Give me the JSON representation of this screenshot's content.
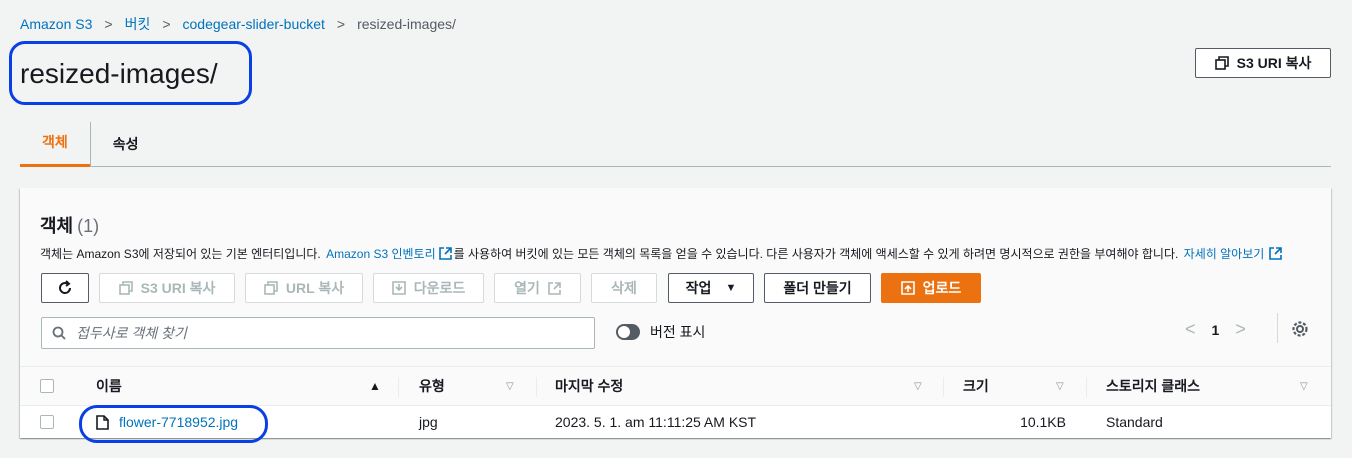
{
  "breadcrumb": [
    "Amazon S3",
    "버킷",
    "codegear-slider-bucket",
    "resized-images/"
  ],
  "title": "resized-images/",
  "s3_uri_copy_label": "S3 URI 복사",
  "tabs": [
    {
      "label": "객체",
      "active": true
    },
    {
      "label": "속성",
      "active": false
    }
  ],
  "panel": {
    "title": "객체",
    "count": "(1)",
    "desc_before": "객체는 Amazon S3에 저장되어 있는 기본 엔터티입니다. ",
    "desc_link1": "Amazon S3 인벤토리",
    "desc_middle": "를 사용하여 버킷에 있는 모든 객체의 목록을 얻을 수 있습니다. 다른 사용자가 객체에 액세스할 수 있게 하려면 명시적으로 권한을 부여해야 합니다. ",
    "desc_link2": "자세히 알아보기"
  },
  "toolbar": {
    "refresh": "refresh",
    "s3_uri_copy": "S3 URI 복사",
    "url_copy": "URL 복사",
    "download": "다운로드",
    "open": "열기",
    "delete": "삭제",
    "actions": "작업",
    "create_folder": "폴더 만들기",
    "upload": "업로드"
  },
  "search": {
    "placeholder": "접두사로 객체 찾기"
  },
  "toggle": {
    "label": "버전 표시"
  },
  "pager": {
    "page": "1"
  },
  "table": {
    "headers": [
      "이름",
      "유형",
      "마지막 수정",
      "크기",
      "스토리지 클래스"
    ],
    "rows": [
      {
        "name": "flower-7718952.jpg",
        "type": "jpg",
        "modified": "2023. 5. 1. am 11:11:25 AM KST",
        "size": "10.1KB",
        "storage": "Standard"
      }
    ]
  },
  "colors": {
    "accent": "#ec7211",
    "link": "#0073bb",
    "highlight": "#0a3fe6"
  }
}
